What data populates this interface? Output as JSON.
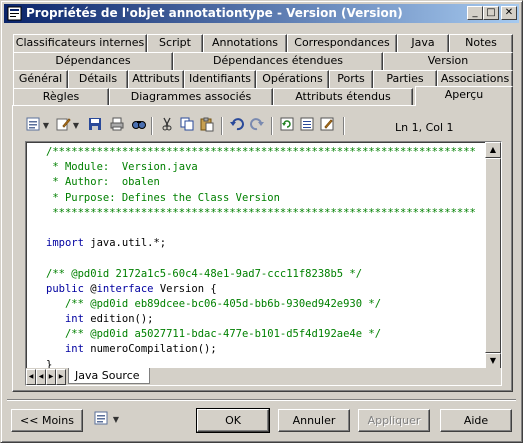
{
  "window": {
    "title": "Propriétés de l'objet annotationtype - Version (Version)",
    "minimize": "_",
    "maximize": "□",
    "close": "✕"
  },
  "tabs": {
    "row1": [
      "Classificateurs internes",
      "Script",
      "Annotations",
      "Correspondances",
      "Java",
      "Notes"
    ],
    "row2": [
      "Dépendances",
      "Dépendances étendues",
      "Version"
    ],
    "row3": [
      "Général",
      "Détails",
      "Attributs",
      "Identifiants",
      "Opérations",
      "Ports",
      "Parties",
      "Associations"
    ],
    "row4": [
      "Règles",
      "Diagrammes associés",
      "Attributs étendus",
      "Aperçu"
    ],
    "active": "Aperçu"
  },
  "toolbar": {
    "position": "Ln 1, Col 1",
    "icons": [
      "properties-icon",
      "edit-icon",
      "save-icon",
      "print-icon",
      "find-icon",
      "cut-icon",
      "copy-icon",
      "paste-icon",
      "undo-icon",
      "redo-icon",
      "refresh-icon",
      "view-icon",
      "edit-text-icon"
    ]
  },
  "code": [
    {
      "t": "/*******************************************************************",
      "c": "comment"
    },
    {
      "t": " * Module:  Version.java",
      "c": "comment"
    },
    {
      "t": " * Author:  obalen",
      "c": "comment"
    },
    {
      "t": " * Purpose: Defines the Class Version",
      "c": "comment"
    },
    {
      "t": " *******************************************************************",
      "c": "comment"
    },
    {
      "t": "",
      "c": "plain"
    },
    {
      "t": "import java.util.*;",
      "c": "import"
    },
    {
      "t": "",
      "c": "plain"
    },
    {
      "t": "/** @pd0id 2172a1c5-60c4-48e1-9ad7-ccc11f8238b5 */",
      "c": "comment"
    },
    {
      "t": "public @interface Version {",
      "c": "decl"
    },
    {
      "t": "   /** @pd0id eb89dcee-bc06-405d-bb6b-930ed942e930 */",
      "c": "comment"
    },
    {
      "t": "   int edition();",
      "c": "member"
    },
    {
      "t": "   /** @pd0id a5027711-bdac-477e-b101-d5f4d192ae4e */",
      "c": "comment"
    },
    {
      "t": "   int numeroCompilation();",
      "c": "member"
    },
    {
      "t": "}",
      "c": "plain"
    }
  ],
  "sheet_tab": "Java Source",
  "buttons": {
    "less": "<< Moins",
    "ok": "OK",
    "cancel": "Annuler",
    "apply": "Appliquer",
    "help": "Aide"
  }
}
